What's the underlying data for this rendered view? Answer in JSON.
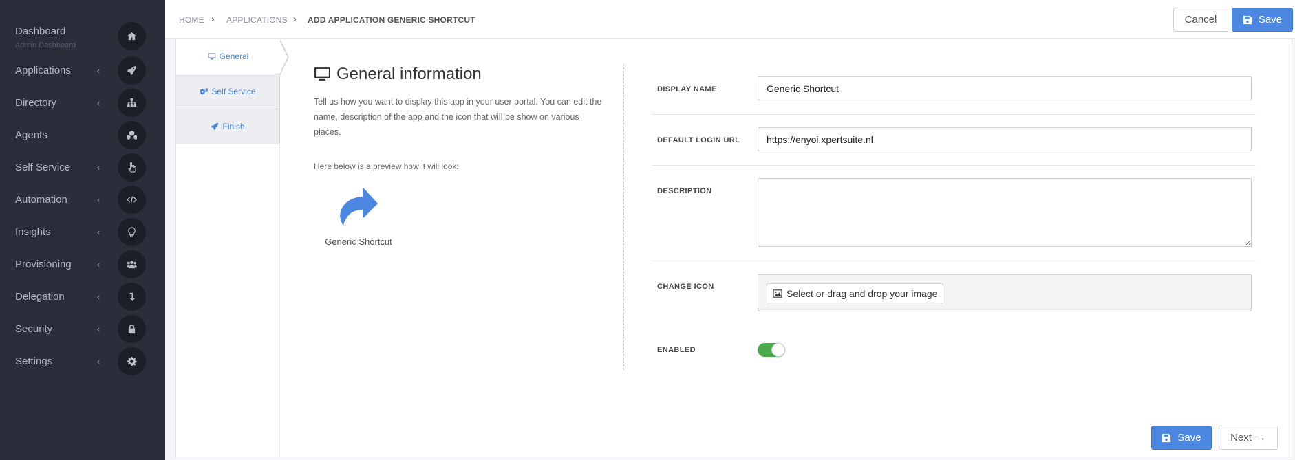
{
  "sidebar": {
    "items": [
      {
        "label": "Dashboard",
        "sub": "Admin Dashboard",
        "icon": "home-icon",
        "chevron": ""
      },
      {
        "label": "Applications",
        "icon": "rocket-icon",
        "chevron": "‹"
      },
      {
        "label": "Directory",
        "icon": "sitemap-icon",
        "chevron": "‹"
      },
      {
        "label": "Agents",
        "icon": "cubes-icon",
        "chevron": ""
      },
      {
        "label": "Self Service",
        "icon": "hand-pointer-icon",
        "chevron": "‹"
      },
      {
        "label": "Automation",
        "icon": "code-icon",
        "chevron": "‹"
      },
      {
        "label": "Insights",
        "icon": "lightbulb-icon",
        "chevron": "‹"
      },
      {
        "label": "Provisioning",
        "icon": "users-icon",
        "chevron": "‹"
      },
      {
        "label": "Delegation",
        "icon": "level-down-icon",
        "chevron": "‹"
      },
      {
        "label": "Security",
        "icon": "lock-icon",
        "chevron": "‹"
      },
      {
        "label": "Settings",
        "icon": "cog-icon",
        "chevron": "‹"
      }
    ]
  },
  "breadcrumb": {
    "home": "HOME",
    "applications": "APPLICATIONS",
    "current": "ADD APPLICATION GENERIC SHORTCUT",
    "separator": "›"
  },
  "toolbar": {
    "cancel_label": "Cancel",
    "save_label": "Save"
  },
  "steps": [
    {
      "label": "General",
      "icon": "desktop-icon"
    },
    {
      "label": "Self Service",
      "icon": "cogs-icon"
    },
    {
      "label": "Finish",
      "icon": "rocket-icon"
    }
  ],
  "general": {
    "title": "General information",
    "description": "Tell us how you want to display this app in your user portal. You can edit the name, description of the app and the icon that will be show on various places.",
    "preview_text": "Here below is a preview how it will look:",
    "app_name": "Generic Shortcut"
  },
  "form": {
    "display_name_label": "DISPLAY NAME",
    "display_name_value": "Generic Shortcut",
    "login_url_label": "DEFAULT LOGIN URL",
    "login_url_value": "https://enyoi.xpertsuite.nl",
    "description_label": "DESCRIPTION",
    "description_value": "",
    "change_icon_label": "CHANGE ICON",
    "select_image_label": "Select or drag and drop your image",
    "enabled_label": "ENABLED",
    "enabled": true
  },
  "footer": {
    "save_label": "Save",
    "next_label": "Next",
    "next_arrow": "→"
  },
  "colors": {
    "sidebar_bg": "#2a2d3a",
    "primary": "#4b86e0",
    "toggle_on": "#4bab4b",
    "app_icon": "#4b86e0"
  }
}
